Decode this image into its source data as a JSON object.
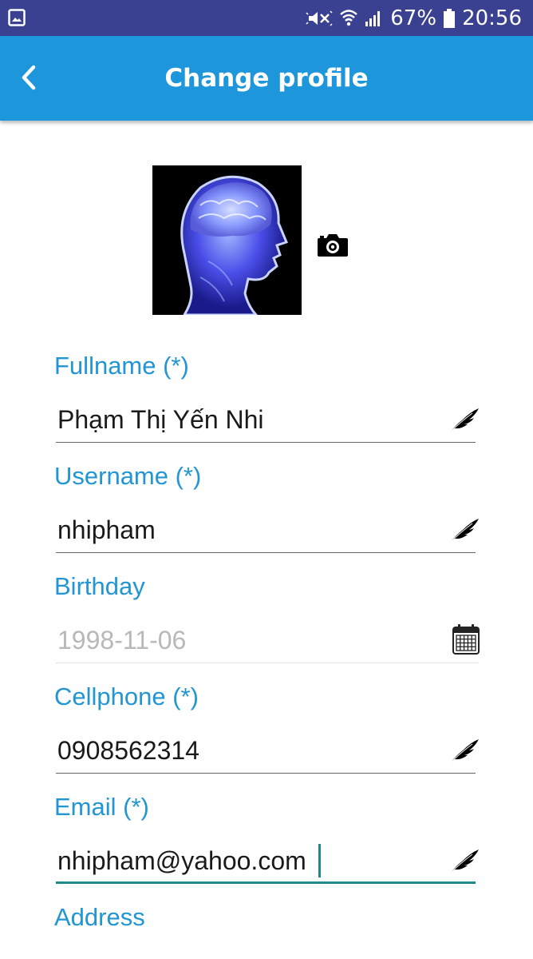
{
  "status_bar": {
    "battery_percent": "67%",
    "time": "20:56",
    "icons": [
      "gallery-icon",
      "mute-icon",
      "wifi-icon",
      "signal-icon",
      "battery-icon"
    ]
  },
  "app_bar": {
    "title": "Change profile",
    "back_icon": "chevron-left-icon",
    "background": "#1e96db"
  },
  "colors": {
    "label": "#2196d3",
    "active_underline": "#1f8a8a",
    "status_bar": "#3a4190"
  },
  "form": {
    "fullname": {
      "label": "Fullname (*)",
      "value": "Phạm Thị Yến Nhi",
      "icon": "quill-icon"
    },
    "username": {
      "label": "Username (*)",
      "value": "nhipham",
      "icon": "quill-icon"
    },
    "birthday": {
      "label": "Birthday",
      "value": "1998-11-06",
      "icon": "calendar-icon"
    },
    "cellphone": {
      "label": "Cellphone (*)",
      "value": "0908562314",
      "icon": "quill-icon"
    },
    "email": {
      "label": "Email (*)",
      "value": "nhipham@yahoo.com",
      "icon": "quill-icon",
      "focused": true
    },
    "address": {
      "label": "Address"
    }
  }
}
